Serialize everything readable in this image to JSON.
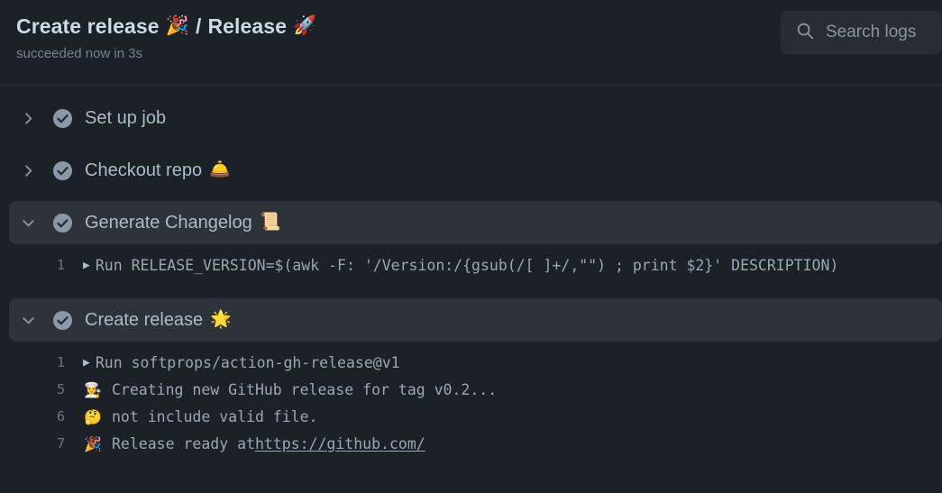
{
  "header": {
    "workflow_name": "Create release",
    "workflow_emoji": "🎉",
    "separator": "/",
    "job_name": "Release",
    "job_emoji": "🚀",
    "status_text": "succeeded now in 3s"
  },
  "search": {
    "icon": "search-icon",
    "placeholder": "Search logs",
    "value": ""
  },
  "steps": [
    {
      "title": "Set up job",
      "emoji": "",
      "status": "success",
      "expanded": false,
      "chevron": "chevron-right-icon",
      "lines": []
    },
    {
      "title": "Checkout repo",
      "emoji": "🛎️",
      "status": "success",
      "expanded": false,
      "chevron": "chevron-right-icon",
      "lines": []
    },
    {
      "title": "Generate Changelog",
      "emoji": "📜",
      "status": "success",
      "expanded": true,
      "chevron": "chevron-down-icon",
      "lines": [
        {
          "number": "1",
          "marker": "▶",
          "emoji": "",
          "text": "Run RELEASE_VERSION=$(awk -F: '/Version:/{gsub(/[ ]+/,\"\") ; print $2}' DESCRIPTION)",
          "link": ""
        }
      ]
    },
    {
      "title": "Create release",
      "emoji": "🌟",
      "status": "success",
      "expanded": true,
      "chevron": "chevron-down-icon",
      "lines": [
        {
          "number": "1",
          "marker": "▶",
          "emoji": "",
          "text": "Run softprops/action-gh-release@v1",
          "link": ""
        },
        {
          "number": "5",
          "marker": "",
          "emoji": "👩‍🍳",
          "text": "Creating new GitHub release for tag v0.2...",
          "link": ""
        },
        {
          "number": "6",
          "marker": "",
          "emoji": "🤔",
          "text": "not include valid file.",
          "link": ""
        },
        {
          "number": "7",
          "marker": "",
          "emoji": "🎉",
          "text": "Release ready at ",
          "link": "https://github.com/"
        }
      ]
    }
  ],
  "colors": {
    "background": "#1c2027",
    "row_highlight": "#2d323b",
    "text": "#adbac7",
    "muted": "#768390",
    "status_success": "#8b98a8"
  }
}
